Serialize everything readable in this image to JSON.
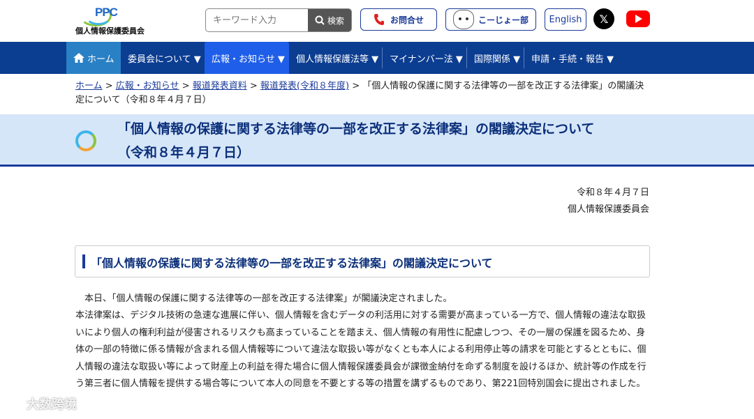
{
  "header": {
    "logo_mark": "PPC",
    "logo_name": "個人情報保護委員会",
    "search_placeholder": "キーワード入力",
    "search_button": "検索",
    "contact_label": "お問合せ",
    "kojo_label": "こーじょー部",
    "english_label": "English"
  },
  "nav": {
    "items": [
      {
        "label": "ホーム"
      },
      {
        "label": "委員会について ▼"
      },
      {
        "label": "広報・お知らせ ▼"
      },
      {
        "label": "個人情報保護法等 ▼"
      },
      {
        "label": "マイナンバー法 ▼"
      },
      {
        "label": "国際関係 ▼"
      },
      {
        "label": "申請・手続・報告 ▼"
      }
    ]
  },
  "breadcrumb": {
    "items": [
      "ホーム",
      "広報・お知らせ",
      "報道発表資料",
      "報道発表(令和８年度)"
    ],
    "separator": " > ",
    "current": "「個人情報の保護に関する法律等の一部を改正する法律案」の閣議決定について（令和８年４月７日）"
  },
  "page": {
    "title_line1": "「個人情報の保護に関する法律等の一部を改正する法律案」の閣議決定について",
    "title_line2": "（令和８年４月７日）",
    "date": "令和８年４月７日",
    "issuer": "個人情報保護委員会",
    "section_heading": "「個人情報の保護に関する法律等の一部を改正する法律案」の閣議決定について",
    "para1": "　本日、「個人情報の保護に関する法律等の一部を改正する法律案」が閣議決定されました。",
    "para2": "本法律案は、デジタル技術の急速な進展に伴い、個人情報を含むデータの利活用に対する需要が高まっている一方で、個人情報の違法な取扱いにより個人の権利利益が侵害されるリスクも高まっていることを踏まえ、個人情報の有用性に配慮しつつ、その一層の保護を図るため、身体の一部の特徴に係る情報が含まれる個人情報等について違法な取扱い等がなくとも本人による利用停止等の請求を可能とするとともに、個人情報の違法な取扱い等によって財産上の利益を得た場合に個人情報保護委員会が課徴金納付を命ずる制度を設けるほか、統計等の作成を行う第三者に個人情報を提供する場合等について本人の同意を不要とする等の措置を講ずるものであり、第221回特別国会に提出されました。"
  },
  "watermark": "大数跨境",
  "colors": {
    "nav_bg": "#0b3d91",
    "nav_home_bg": "#2a80c4",
    "nav_current_bg": "#1f5ee8",
    "title_band": "#d6e6f9",
    "heading_text": "#0b2f7a"
  }
}
